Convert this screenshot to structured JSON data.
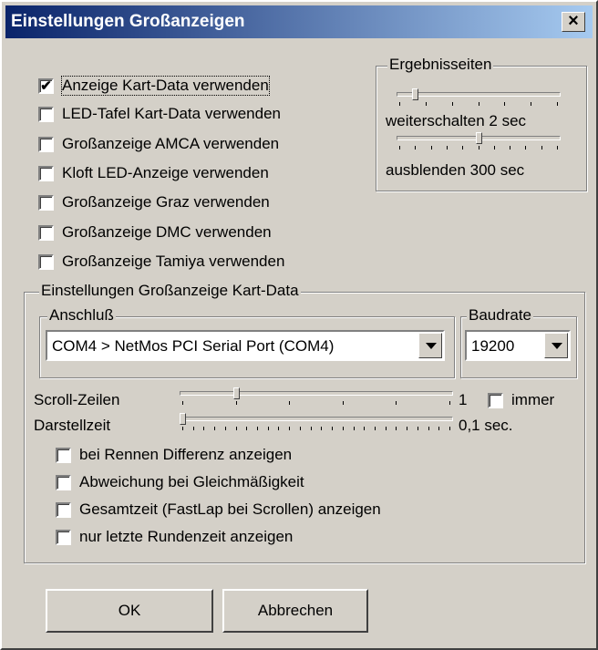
{
  "window": {
    "title": "Einstellungen Großanzeigen"
  },
  "display_options": [
    {
      "label": "Anzeige Kart-Data verwenden",
      "checked": true
    },
    {
      "label": "LED-Tafel Kart-Data verwenden",
      "checked": false
    },
    {
      "label": "Großanzeige AMCA verwenden",
      "checked": false
    },
    {
      "label": "Kloft LED-Anzeige verwenden",
      "checked": false
    },
    {
      "label": "Großanzeige Graz verwenden",
      "checked": false
    },
    {
      "label": "Großanzeige DMC verwenden",
      "checked": false
    },
    {
      "label": "Großanzeige Tamiya verwenden",
      "checked": false
    }
  ],
  "results_pages": {
    "title": "Ergebnisseiten",
    "advance_label": "weiterschalten 2 sec",
    "advance_level": 0.1,
    "fade_label": "ausblenden 300 sec",
    "fade_level": 0.5
  },
  "kartdata": {
    "title": "Einstellungen Großanzeige Kart-Data",
    "port": {
      "title": "Anschluß",
      "value": "COM4 > NetMos PCI Serial Port (COM4)"
    },
    "baud": {
      "title": "Baudrate",
      "value": "19200"
    },
    "scroll": {
      "label": "Scroll-Zeilen",
      "value": "1",
      "level": 0.2,
      "always_label": "immer",
      "always_checked": false
    },
    "display_time": {
      "label": "Darstellzeit",
      "value": "0,1 sec.",
      "level": 0.0
    },
    "options": [
      {
        "label": "bei Rennen Differenz anzeigen",
        "checked": false
      },
      {
        "label": "Abweichung bei Gleichmäßigkeit",
        "checked": false
      },
      {
        "label": "Gesamtzeit (FastLap bei Scrollen) anzeigen",
        "checked": false
      },
      {
        "label": "nur letzte Rundenzeit anzeigen",
        "checked": false
      }
    ]
  },
  "buttons": {
    "ok": "OK",
    "cancel": "Abbrechen"
  },
  "colors": {
    "title_start": "#0a246a",
    "title_end": "#a6caf0",
    "face": "#d4d0c8"
  }
}
